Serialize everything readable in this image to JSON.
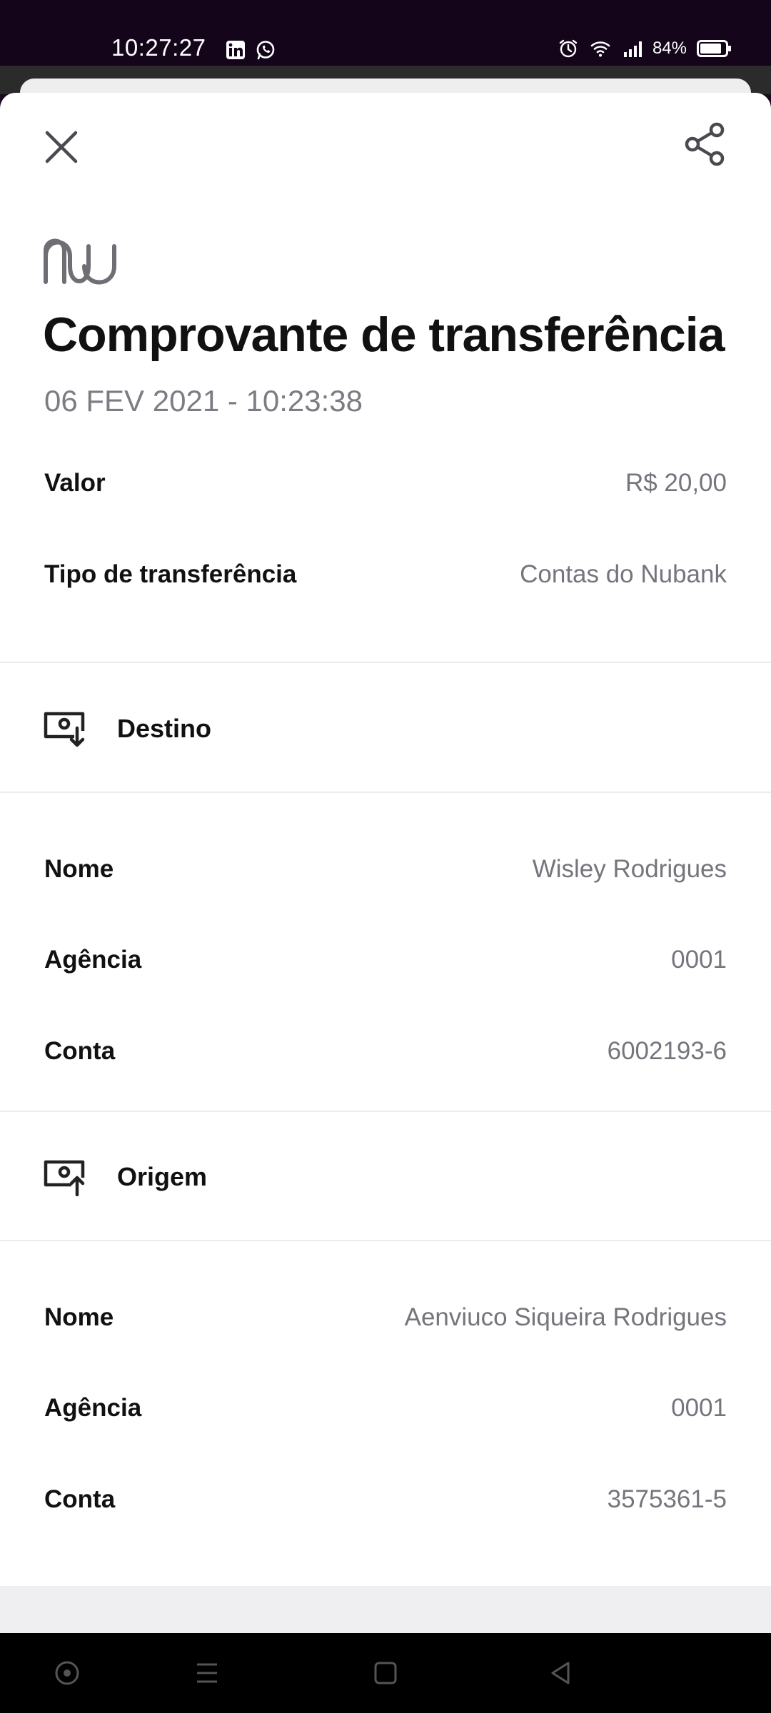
{
  "status_bar": {
    "time": "10:27:27",
    "battery": "84%",
    "battery_level": 0.84,
    "left_icons": [
      "linkedin-icon",
      "whatsapp-icon"
    ],
    "right_icons": [
      "alarm-icon",
      "wifi-icon",
      "signal-icon",
      "battery-icon"
    ]
  },
  "header": {
    "close_icon": "close-icon",
    "share_icon": "share-icon",
    "logo": "nu-logo"
  },
  "receipt": {
    "title": "Comprovante de transferência",
    "datetime": "06 FEV 2021 - 10:23:38",
    "value_label": "Valor",
    "value": "R$ 20,00",
    "type_label": "Tipo de transferência",
    "type": "Contas do Nubank"
  },
  "destino": {
    "title": "Destino",
    "icon": "money-in-icon",
    "nome_label": "Nome",
    "nome": "Wisley Rodrigues",
    "agencia_label": "Agência",
    "agencia": "0001",
    "conta_label": "Conta",
    "conta": "6002193-6"
  },
  "origem": {
    "title": "Origem",
    "icon": "money-out-icon",
    "nome_label": "Nome",
    "nome": "Aenviuco Siqueira Rodrigues",
    "agencia_label": "Agência",
    "agencia": "0001",
    "conta_label": "Conta",
    "conta": "3575361-5"
  },
  "nav_bar": {
    "items": [
      "assistant-icon",
      "menu-icon",
      "home-icon",
      "back-icon"
    ]
  },
  "colors": {
    "status_bg": "#14051b",
    "label": "#111111",
    "value": "#76747c",
    "divider": "#ececef"
  }
}
